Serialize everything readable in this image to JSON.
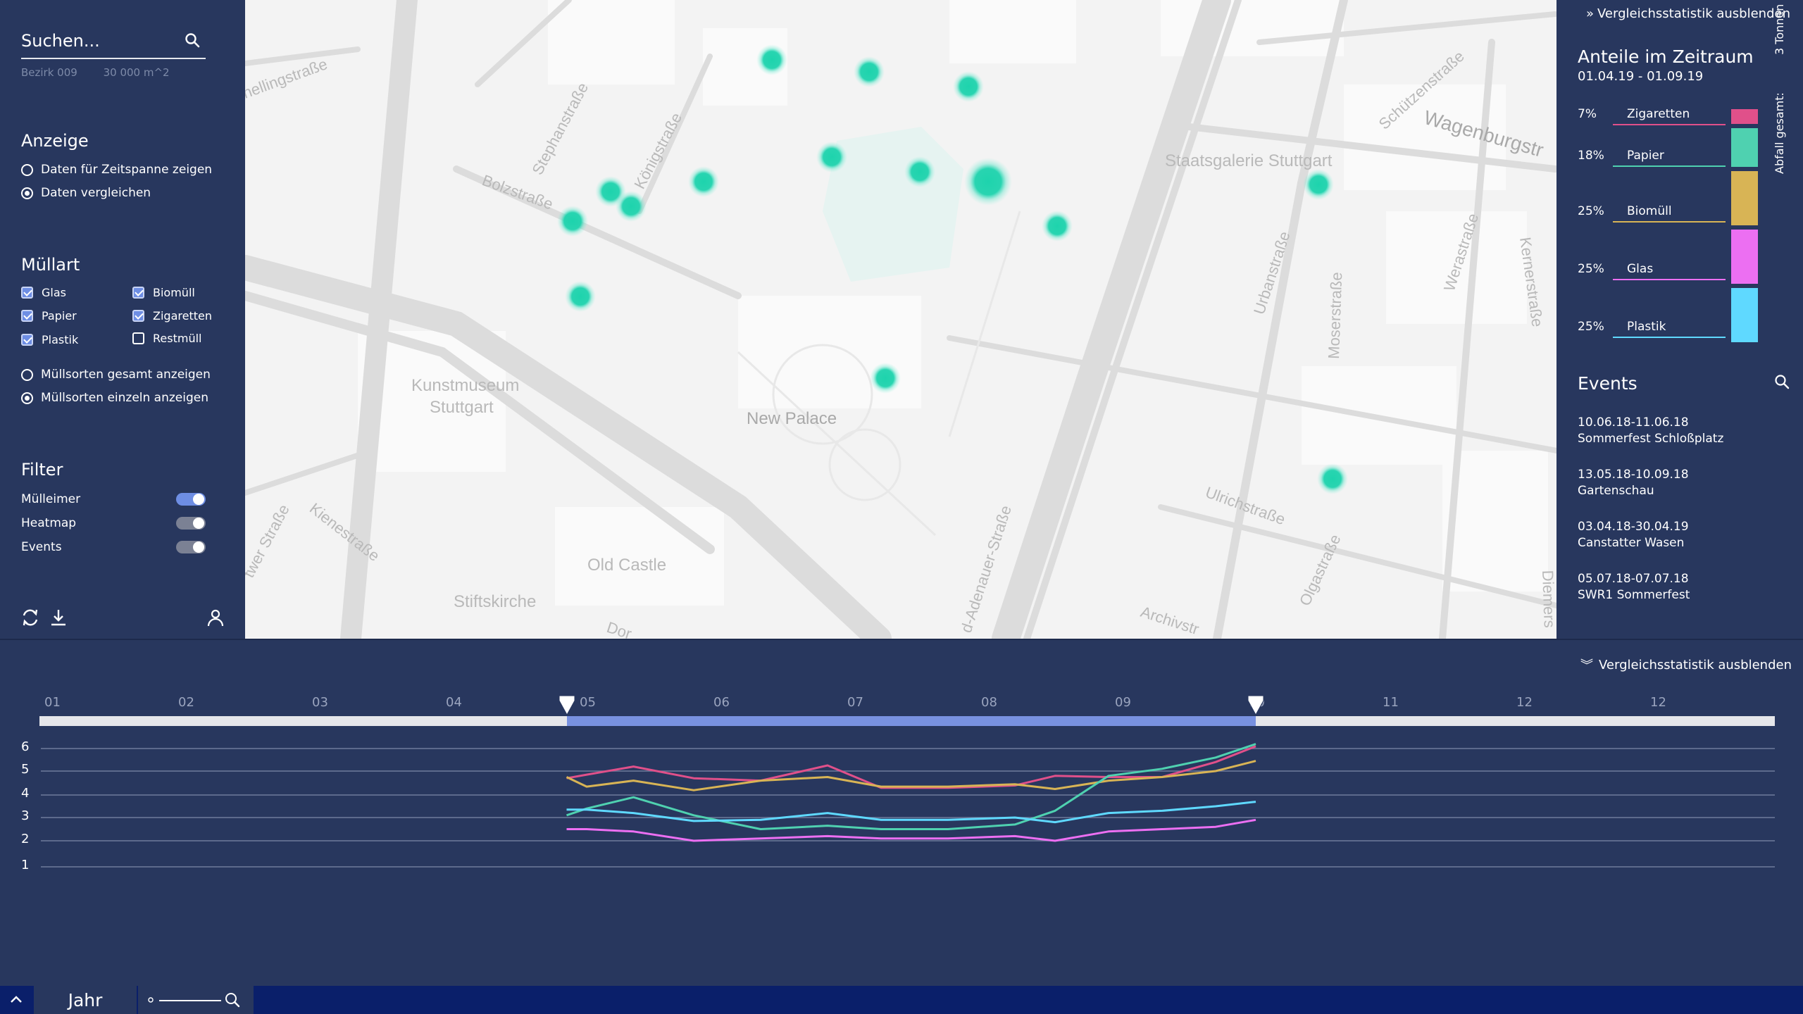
{
  "search": {
    "placeholder": "Suchen...",
    "meta": [
      "Bezirk 009",
      "30 000 m^2"
    ]
  },
  "display": {
    "title": "Anzeige",
    "options": [
      {
        "label": "Daten für Zeitspanne zeigen",
        "selected": false
      },
      {
        "label": "Daten vergleichen",
        "selected": true
      }
    ]
  },
  "waste": {
    "title": "Müllart",
    "types": [
      {
        "label": "Glas",
        "checked": true
      },
      {
        "label": "Biomüll",
        "checked": true
      },
      {
        "label": "Papier",
        "checked": true
      },
      {
        "label": "Zigaretten",
        "checked": true
      },
      {
        "label": "Plastik",
        "checked": true
      },
      {
        "label": "Restmüll",
        "checked": false
      }
    ],
    "modes": [
      {
        "label": "Müllsorten gesamt anzeigen",
        "selected": false
      },
      {
        "label": "Müllsorten einzeln anzeigen",
        "selected": true
      }
    ]
  },
  "filter": {
    "title": "Filter",
    "toggles": [
      {
        "label": "Mülleimer",
        "on": true
      },
      {
        "label": "Heatmap",
        "on": false
      },
      {
        "label": "Events",
        "on": false
      }
    ]
  },
  "map": {
    "labels": {
      "stuttgart_street": "nellingstraße",
      "stephan": "Stephanstraße",
      "koenig": "Königstraße",
      "bolz": "Bolzstraße",
      "kunstmuseum1": "Kunstmuseum",
      "kunstmuseum2": "Stuttgart",
      "newpalace": "New Palace",
      "oldcastle": "Old Castle",
      "stiftskirche": "Stiftskirche",
      "staatsgalerie": "Staatsgalerie Stuttgart",
      "wagenburg": "Wagenburgstr",
      "schuetzen": "Schützenstraße",
      "urban": "Urbanstraße",
      "moser": "Moserstraße",
      "wera": "Werastraße",
      "kerner": "Kernerstraße",
      "ulrich": "Ulrichstraße",
      "olga": "Olgastraße",
      "archiv": "Archivstr",
      "adenauer": "d-Adenauer-Straße",
      "kiene": "Kienestraße",
      "calwer": "twer Straße",
      "dor": "Dor",
      "diemers": "Diemers"
    }
  },
  "right_panel": {
    "toggle_label": "Vergleichsstatistik ausblenden",
    "title": "Anteile im Zeitraum",
    "date_range": "01.04.19 - 01.09.19",
    "shares": [
      {
        "pct": "7%",
        "name": "Zigaretten",
        "color": "#e0508a",
        "fraction": 0.07
      },
      {
        "pct": "18%",
        "name": "Papier",
        "color": "#4fd1b0",
        "fraction": 0.18
      },
      {
        "pct": "25%",
        "name": "Biomüll",
        "color": "#d8b455",
        "fraction": 0.25
      },
      {
        "pct": "25%",
        "name": "Glas",
        "color": "#ec6ff2",
        "fraction": 0.25
      },
      {
        "pct": "25%",
        "name": "Plastik",
        "color": "#5fd9ff",
        "fraction": 0.25
      }
    ],
    "total_label": "Abfall gesamt:",
    "total_value": "3 Tonnen",
    "events_title": "Events",
    "events": [
      {
        "date": "10.06.18-11.06.18",
        "name": "Sommerfest Schloßplatz"
      },
      {
        "date": "13.05.18-10.09.18",
        "name": "Gartenschau"
      },
      {
        "date": "03.04.18-30.04.19",
        "name": "Canstatter Wasen"
      },
      {
        "date": "05.07.18-07.07.18",
        "name": "SWR1 Sommerfest"
      }
    ]
  },
  "timeline": {
    "toggle_label": "Vergleichsstatistik ausblenden",
    "months": [
      "01",
      "02",
      "03",
      "04",
      "05",
      "06",
      "07",
      "08",
      "09",
      "10",
      "11",
      "12",
      "12"
    ],
    "range_start_month": 4.85,
    "range_end_month": 10.0,
    "y_ticks": [
      "6",
      "5",
      "4",
      "3",
      "2",
      "1"
    ]
  },
  "chart_data": {
    "type": "line",
    "x": [
      4.85,
      5.0,
      5.35,
      5.8,
      6.3,
      6.8,
      7.2,
      7.7,
      8.2,
      8.5,
      8.9,
      9.3,
      9.7,
      10.0
    ],
    "y_ticks": [
      1,
      2,
      3,
      4,
      5,
      6
    ],
    "series": [
      {
        "color": "#e0508a",
        "values": [
          4.7,
          4.85,
          5.2,
          4.7,
          4.6,
          5.25,
          4.3,
          4.3,
          4.4,
          4.8,
          4.75,
          4.75,
          5.4,
          6.1
        ]
      },
      {
        "color": "#d8b455",
        "values": [
          4.75,
          4.35,
          4.6,
          4.2,
          4.6,
          4.75,
          4.35,
          4.35,
          4.45,
          4.25,
          4.6,
          4.75,
          5.0,
          5.45
        ]
      },
      {
        "color": "#4fd1b0",
        "values": [
          3.1,
          3.4,
          3.9,
          3.1,
          2.5,
          2.65,
          2.5,
          2.5,
          2.7,
          3.3,
          4.8,
          5.1,
          5.6,
          6.2
        ]
      },
      {
        "color": "#5fd9ff",
        "values": [
          3.35,
          3.35,
          3.2,
          2.85,
          2.9,
          3.2,
          2.9,
          2.9,
          3.0,
          2.8,
          3.2,
          3.3,
          3.5,
          3.7
        ]
      },
      {
        "color": "#ec6ff2",
        "values": [
          2.5,
          2.5,
          2.4,
          2.0,
          2.1,
          2.2,
          2.1,
          2.1,
          2.2,
          2.0,
          2.4,
          2.5,
          2.6,
          2.9
        ]
      }
    ]
  },
  "bottom_bar": {
    "year_label": "Jahr"
  }
}
